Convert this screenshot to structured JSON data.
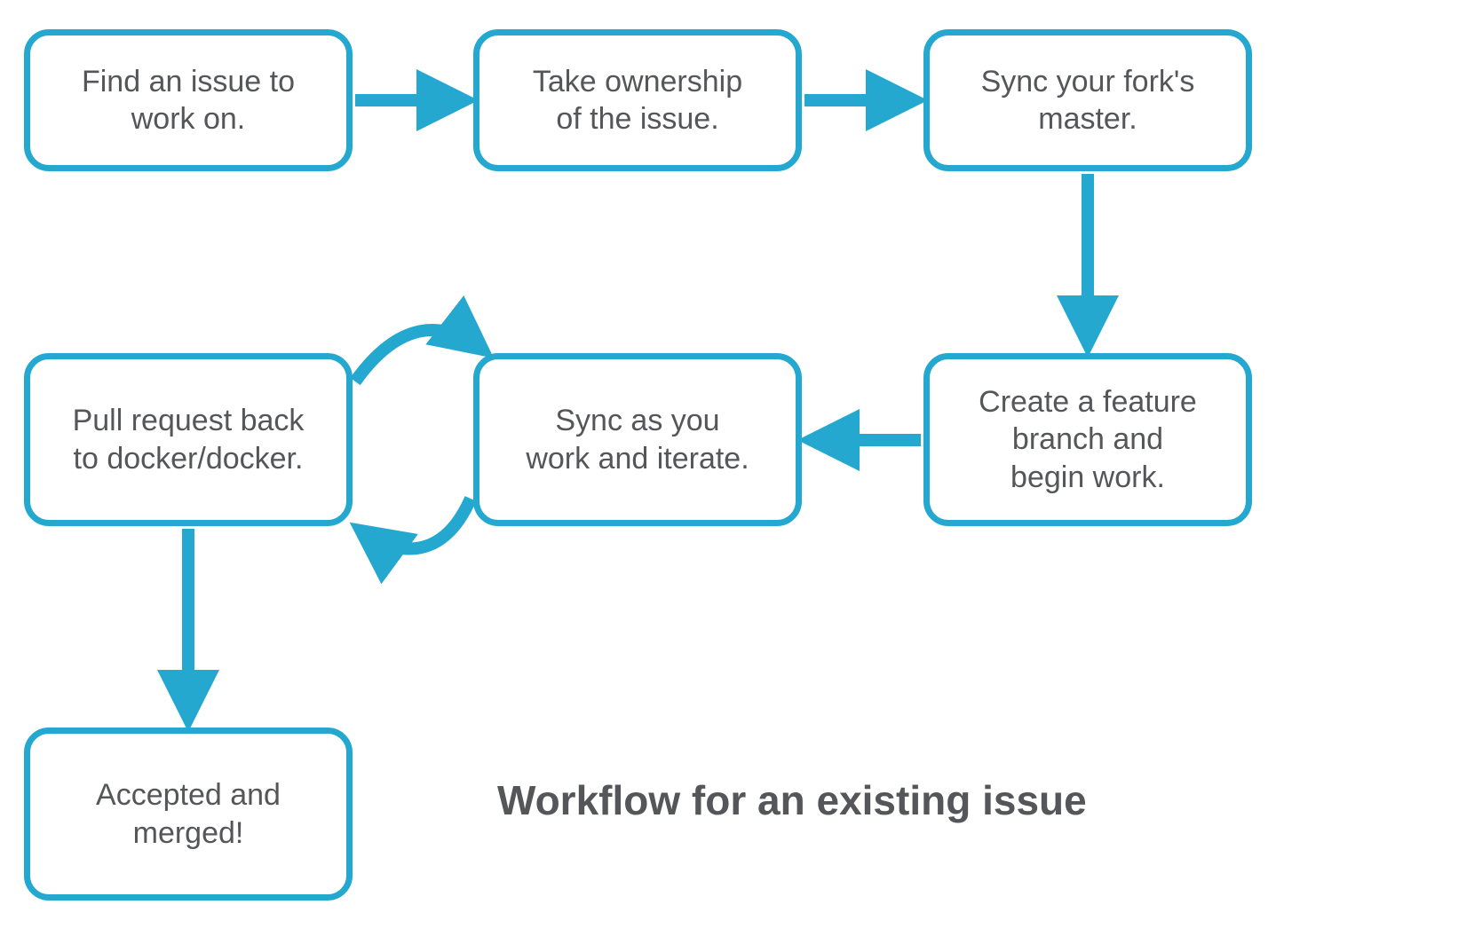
{
  "colors": {
    "accent": "#24a8cf",
    "text": "#555659"
  },
  "nodes": {
    "find_issue": {
      "line1": "Find an issue to",
      "line2": "work on."
    },
    "take_owner": {
      "line1": "Take ownership",
      "line2": "of the issue."
    },
    "sync_fork": {
      "line1": "Sync your fork's",
      "line2": "master."
    },
    "create_branch": {
      "line1": "Create a feature",
      "line2": "branch and",
      "line3": "begin work."
    },
    "sync_iterate": {
      "line1": "Sync as you",
      "line2": "work and iterate."
    },
    "pull_request": {
      "line1": "Pull request back",
      "line2": "to docker/docker."
    },
    "accepted": {
      "line1": "Accepted and",
      "line2": "merged!"
    }
  },
  "title": "Workflow for an existing issue",
  "chart_data": {
    "type": "flowchart",
    "title": "Workflow for an existing issue",
    "nodes": [
      {
        "id": "find_issue",
        "label": "Find an issue to work on."
      },
      {
        "id": "take_owner",
        "label": "Take ownership of the issue."
      },
      {
        "id": "sync_fork",
        "label": "Sync your fork's master."
      },
      {
        "id": "create_branch",
        "label": "Create a feature branch and begin work."
      },
      {
        "id": "sync_iterate",
        "label": "Sync as you work and iterate."
      },
      {
        "id": "pull_request",
        "label": "Pull request back to docker/docker."
      },
      {
        "id": "accepted",
        "label": "Accepted and merged!"
      }
    ],
    "edges": [
      {
        "from": "find_issue",
        "to": "take_owner"
      },
      {
        "from": "take_owner",
        "to": "sync_fork"
      },
      {
        "from": "sync_fork",
        "to": "create_branch"
      },
      {
        "from": "create_branch",
        "to": "sync_iterate"
      },
      {
        "from": "sync_iterate",
        "to": "pull_request",
        "bidirectional": true
      },
      {
        "from": "pull_request",
        "to": "accepted"
      }
    ]
  }
}
